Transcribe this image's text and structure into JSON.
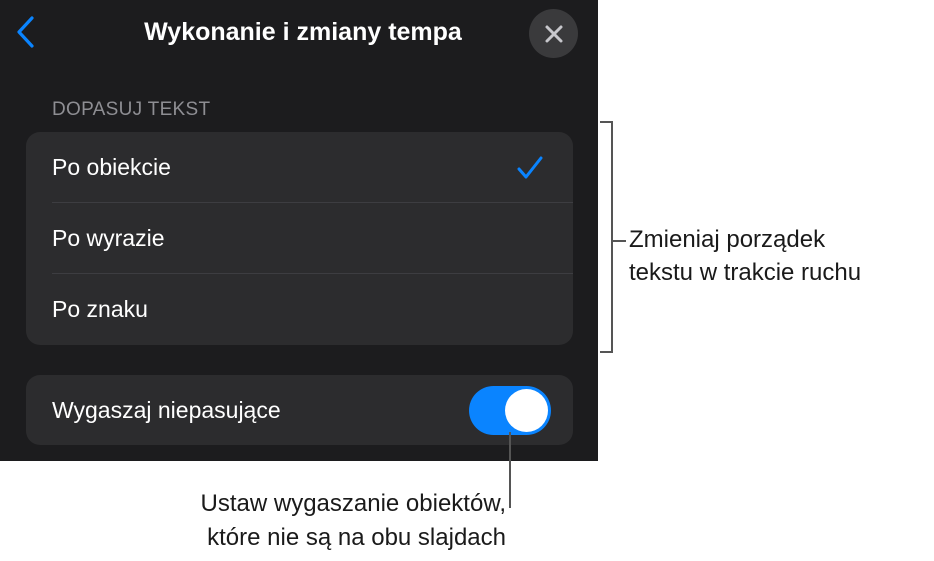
{
  "header": {
    "title": "Wykonanie i zmiany tempa",
    "back_icon": "chevron-left-icon",
    "close_icon": "close-icon"
  },
  "section": {
    "header": "DOPASUJ TEKST",
    "options": [
      {
        "label": "Po obiekcie",
        "selected": true
      },
      {
        "label": "Po wyrazie",
        "selected": false
      },
      {
        "label": "Po znaku",
        "selected": false
      }
    ]
  },
  "toggle": {
    "label": "Wygaszaj niepasujące",
    "on": true
  },
  "callouts": {
    "right": [
      "Zmieniaj porządek",
      "tekstu w trakcie ruchu"
    ],
    "bottom": [
      "Ustaw wygaszanie obiektów,",
      "które nie są na obu slajdach"
    ]
  },
  "colors": {
    "panel_bg": "#1c1c1e",
    "cell_bg": "#2c2c2e",
    "accent": "#0a84ff",
    "secondary_text": "#8e8e93"
  }
}
